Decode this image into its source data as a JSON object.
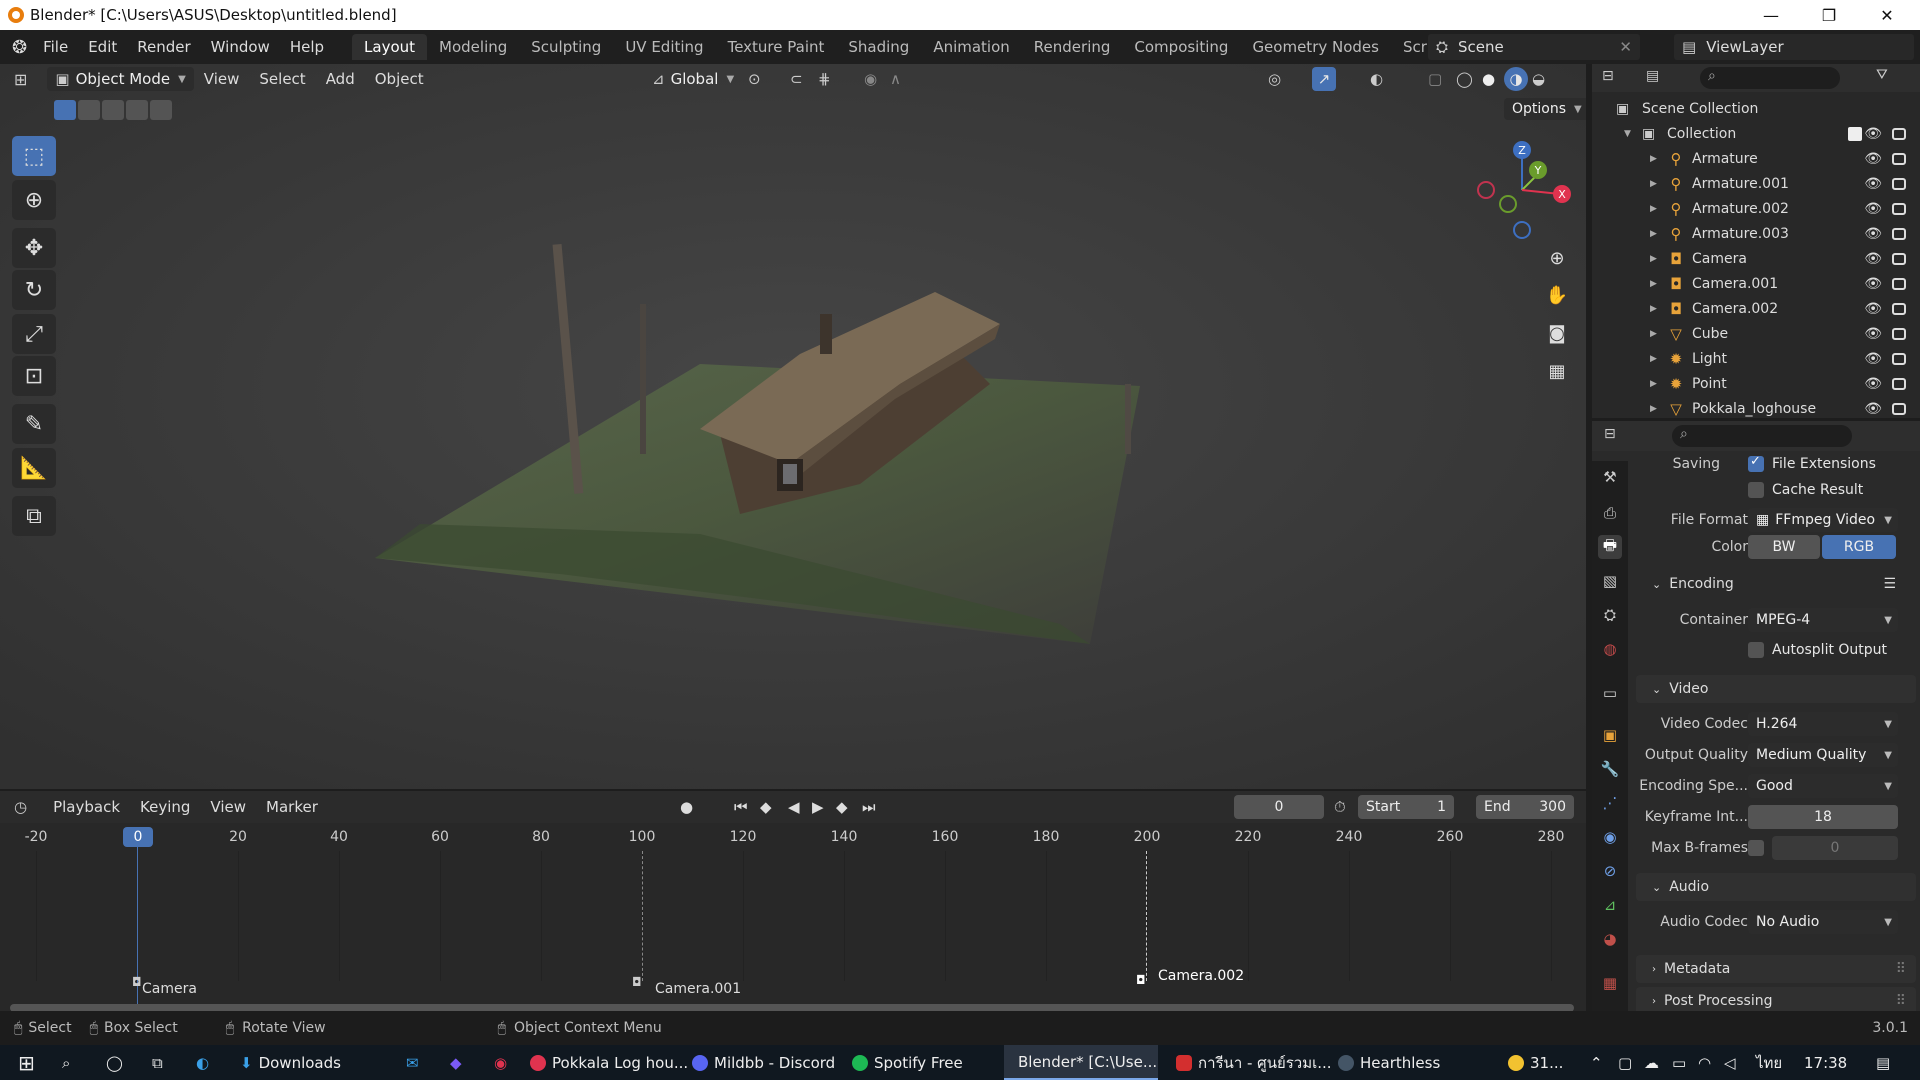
{
  "window": {
    "title": "Blender* [C:\\Users\\ASUS\\Desktop\\untitled.blend]"
  },
  "menu": [
    "File",
    "Edit",
    "Render",
    "Window",
    "Help"
  ],
  "workspaces": [
    "Layout",
    "Modeling",
    "Sculpting",
    "UV Editing",
    "Texture Paint",
    "Shading",
    "Animation",
    "Rendering",
    "Compositing",
    "Geometry Nodes",
    "Scripting"
  ],
  "scene": {
    "scene_name": "Scene",
    "viewlayer": "ViewLayer"
  },
  "viewport": {
    "mode": "Object Mode",
    "menus": [
      "View",
      "Select",
      "Add",
      "Object"
    ],
    "orientation": "Global",
    "options": "Options",
    "gizmo": {
      "z": "Z",
      "y": "Y",
      "x": "X"
    }
  },
  "outliner": {
    "root": "Scene Collection",
    "collection": "Collection",
    "items": [
      "Armature",
      "Armature.001",
      "Armature.002",
      "Armature.003",
      "Camera",
      "Camera.001",
      "Camera.002",
      "Cube",
      "Light",
      "Point",
      "Pokkala_loghouse"
    ]
  },
  "properties": {
    "saving": "Saving",
    "file_extensions": "File Extensions",
    "cache_result": "Cache Result",
    "file_format_label": "File Format",
    "file_format": "FFmpeg Video",
    "color_label": "Color",
    "bw": "BW",
    "rgb": "RGB",
    "encoding": "Encoding",
    "container_label": "Container",
    "container": "MPEG-4",
    "autosplit": "Autosplit Output",
    "video": "Video",
    "video_codec_label": "Video Codec",
    "video_codec": "H.264",
    "output_quality_label": "Output Quality",
    "output_quality": "Medium Quality",
    "encoding_speed_label": "Encoding Spe...",
    "encoding_speed": "Good",
    "keyframe_label": "Keyframe Int...",
    "keyframe": "18",
    "bframes_label": "Max B-frames",
    "bframes": "0",
    "audio": "Audio",
    "audio_codec_label": "Audio Codec",
    "audio_codec": "No Audio",
    "metadata": "Metadata",
    "post_processing": "Post Processing"
  },
  "timeline": {
    "menus": [
      "Playback",
      "Keying",
      "View",
      "Marker"
    ],
    "current": "0",
    "start_label": "Start",
    "start": "1",
    "end_label": "End",
    "end": "300",
    "ticks": [
      "-20",
      "0",
      "20",
      "40",
      "60",
      "80",
      "100",
      "120",
      "140",
      "160",
      "180",
      "200",
      "220",
      "240",
      "260",
      "280"
    ],
    "markers": [
      "Camera",
      "Camera.001",
      "Camera.002"
    ]
  },
  "statusbar": {
    "select": "Select",
    "box_select": "Box Select",
    "rotate": "Rotate View",
    "context": "Object Context Menu",
    "version": "3.0.1"
  },
  "taskbar": {
    "items": [
      "Downloads",
      "Pokkala Log hou...",
      "Mildbb - Discord",
      "Spotify Free",
      "Blender* [C:\\Use...",
      "การีนา - ศูนย์รวมเ...",
      "Hearthless"
    ],
    "weather": "31...",
    "lang": "ไทย",
    "time": "17:38"
  }
}
